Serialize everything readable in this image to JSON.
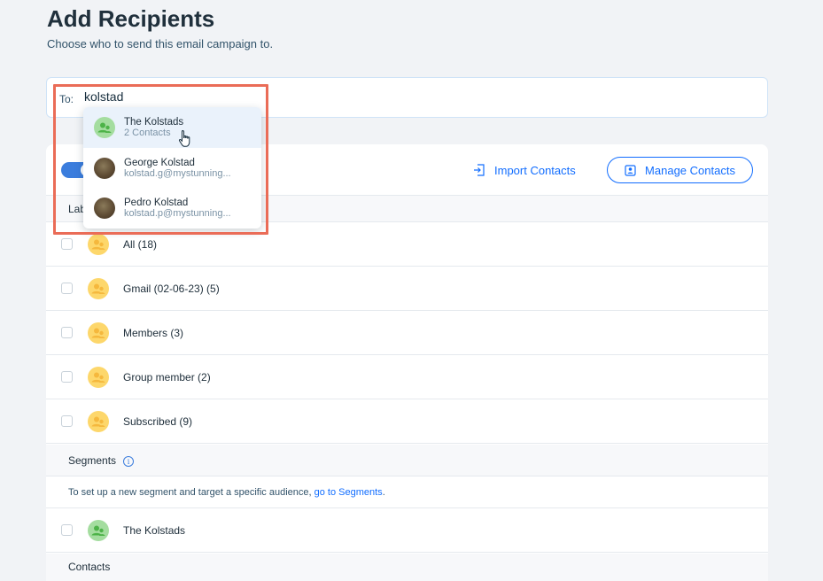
{
  "header": {
    "title": "Add Recipients",
    "subtitle": "Choose who to send this email campaign to."
  },
  "to_field": {
    "label": "To:",
    "value": "kolstad"
  },
  "toolbar": {
    "import_label": "Import Contacts",
    "manage_label": "Manage Contacts",
    "toggle_on": true
  },
  "labels_section": {
    "header_partial": "Lab",
    "rows": [
      {
        "label": "All (18)"
      },
      {
        "label": "Gmail (02-06-23) (5)"
      },
      {
        "label": "Members (3)"
      },
      {
        "label": "Group member (2)"
      },
      {
        "label": "Subscribed (9)"
      }
    ]
  },
  "segments_section": {
    "header": "Segments",
    "info_text": "To set up a new segment and target a specific audience,",
    "info_link": "go to Segments",
    "info_end": ".",
    "rows": [
      {
        "label": "The Kolstads"
      }
    ]
  },
  "contacts_section": {
    "header": "Contacts"
  },
  "dropdown": {
    "items": [
      {
        "name": "The Kolstads",
        "sub": "2 Contacts",
        "type": "group"
      },
      {
        "name": "George Kolstad",
        "sub": "kolstad.g@mystunning...",
        "type": "photo"
      },
      {
        "name": "Pedro Kolstad",
        "sub": "kolstad.p@mystunning...",
        "type": "photo"
      }
    ]
  },
  "colors": {
    "accent": "#116dff",
    "highlight": "#ea6c57",
    "label_avatar": "#fdd76b",
    "segment_avatar": "#a4dd9f"
  }
}
